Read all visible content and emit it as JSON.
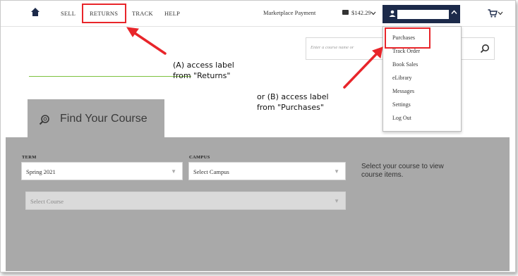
{
  "nav": {
    "links": [
      "SELL",
      "RETURNS",
      "TRACK",
      "HELP"
    ],
    "marketplace_label": "Marketplace Payment",
    "marketplace_amount": "$142.29"
  },
  "search": {
    "placeholder": "Enter a course name or"
  },
  "account_menu": {
    "items": [
      "Purchases",
      "Track Order",
      "Book Sales",
      "eLibrary",
      "Messages",
      "Settings",
      "Log Out"
    ]
  },
  "annotations": {
    "a_line1": "(A) access label",
    "a_line2": "from \"Returns\"",
    "b_line1": "or (B) access label",
    "b_line2": "from \"Purchases\""
  },
  "find_course": {
    "tab_label": "Find Your Course",
    "term_label": "TERM",
    "term_value": "Spring 2021",
    "campus_label": "CAMPUS",
    "campus_value": "Select Campus",
    "course_value": "Select Course",
    "helper_line1": "Select your course to view",
    "helper_line2": "course items."
  },
  "colors": {
    "highlight": "#e8252a",
    "account_bg": "#1c2a4a",
    "panel_bg": "#a9a9a9",
    "accent_line": "#7dc23e"
  },
  "icons": [
    "home-icon",
    "credit-card-icon",
    "chevron-down-icon",
    "user-icon",
    "caret-up-icon",
    "cart-icon",
    "search-icon",
    "dropdown-arrow-icon"
  ]
}
